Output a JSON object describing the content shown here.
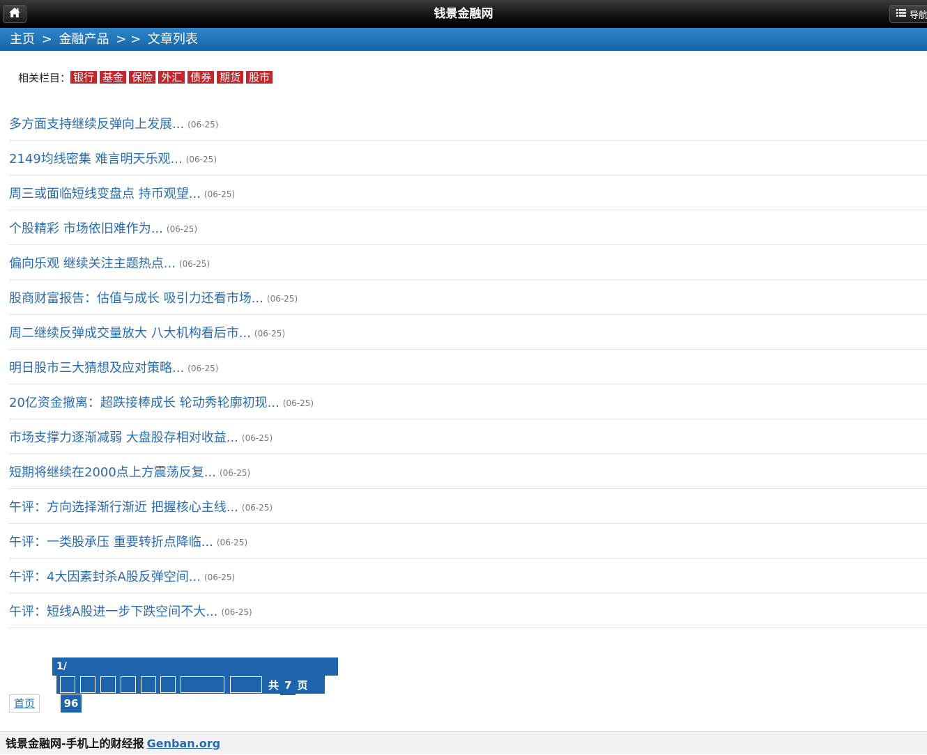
{
  "header": {
    "site_title": "钱景金融网",
    "nav_label": "导航"
  },
  "breadcrumb": {
    "home": "主页",
    "sep1": ">",
    "category": "金融产品",
    "sep2": "> >",
    "current": "文章列表"
  },
  "related": {
    "label": "相关栏目：",
    "tags": [
      "银行",
      "基金",
      "保险",
      "外汇",
      "债券",
      "期货",
      "股市"
    ]
  },
  "articles": [
    {
      "title": "多方面支持继续反弹向上发展...",
      "date": "(06-25)"
    },
    {
      "title": "2149均线密集 难言明天乐观...",
      "date": "(06-25)"
    },
    {
      "title": "周三或面临短线变盘点 持币观望...",
      "date": "(06-25)"
    },
    {
      "title": "个股精彩 市场依旧难作为...",
      "date": "(06-25)"
    },
    {
      "title": "偏向乐观 继续关注主题热点...",
      "date": "(06-25)"
    },
    {
      "title": "股商财富报告：估值与成长 吸引力还看市场...",
      "date": "(06-25)"
    },
    {
      "title": "周二继续反弹成交量放大 八大机构看后市...",
      "date": "(06-25)"
    },
    {
      "title": "明日股市三大猜想及应对策略...",
      "date": "(06-25)"
    },
    {
      "title": "20亿资金撤离：超跌接棒成长 轮动秀轮廓初现...",
      "date": "(06-25)"
    },
    {
      "title": "市场支撑力逐渐减弱 大盘股存相对收益...",
      "date": "(06-25)"
    },
    {
      "title": "短期将继续在2000点上方震荡反复...",
      "date": "(06-25)"
    },
    {
      "title": "午评：方向选择渐行渐近 把握核心主线...",
      "date": "(06-25)"
    },
    {
      "title": "午评：一类股承压 重要转折点降临...",
      "date": "(06-25)"
    },
    {
      "title": "午评：4大因素封杀A股反弹空间...",
      "date": "(06-25)"
    },
    {
      "title": "午评：短线A股进一步下跌空间不大...",
      "date": "(06-25)"
    }
  ],
  "pagination": {
    "current": "1/",
    "total_prefix": "共",
    "total_pages": "7",
    "total_suffix": "页",
    "first_label": "首页",
    "record_count": "96"
  },
  "footer": {
    "text": "钱景金融网-手机上的财经报",
    "brand": "Genban.org"
  }
}
